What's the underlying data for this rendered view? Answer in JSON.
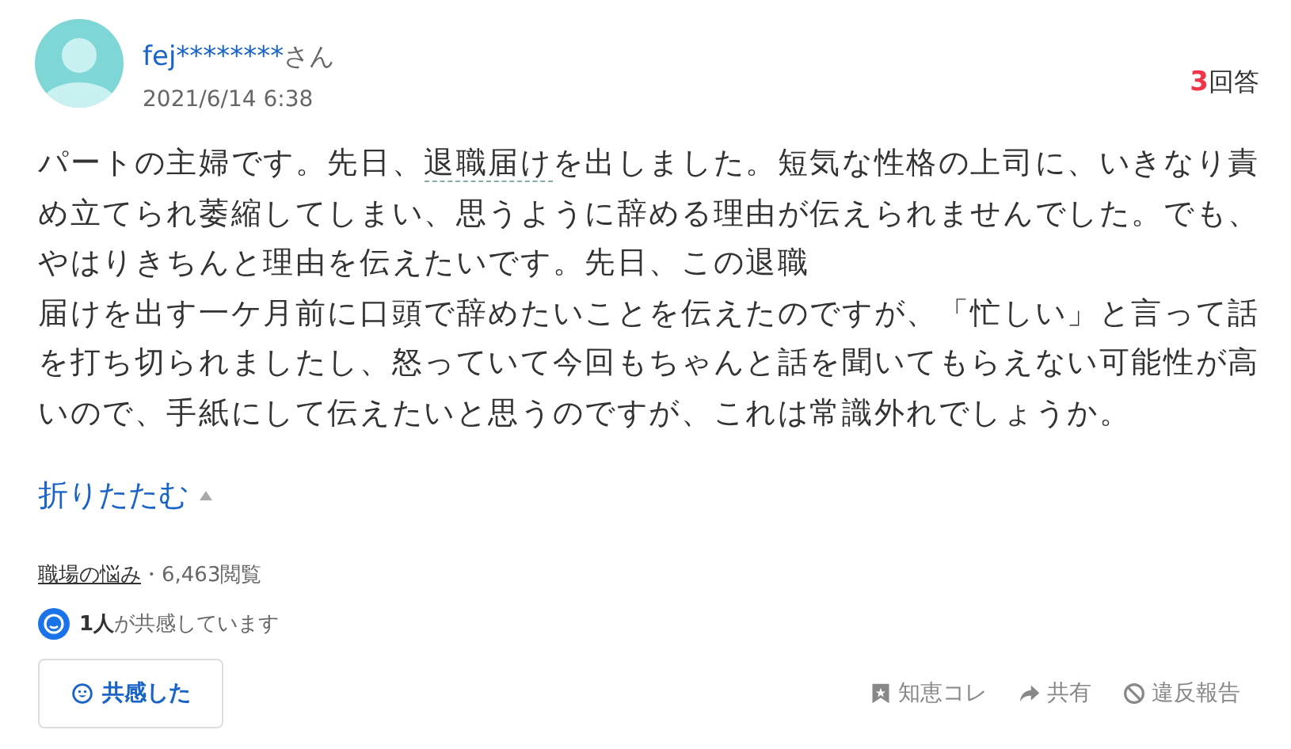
{
  "author": {
    "name": "fej********",
    "suffix": "さん",
    "date": "2021/6/14 6:38"
  },
  "answers": {
    "count": "3",
    "label": "回答"
  },
  "body": [
    [
      {
        "kind": "text",
        "text": "パートの主婦です。先日、"
      },
      {
        "kind": "keyword",
        "text": "退職届け"
      },
      {
        "kind": "text",
        "text": "を出しました。短気な性格の上司に、いきなり責め立てられ萎縮してしまい、思うように辞める理由が伝えられませんでした。でも、やはりきちんと理由を伝えたいです。先日、この退職"
      }
    ],
    [
      {
        "kind": "text",
        "text": "届けを出す一ケ月前に口頭で辞めたいことを伝えたのですが、「忙しい」と言って話を打ち切られましたし、怒っていて今回もちゃんと話を聞いてもらえない可能性が高いので、手紙にして伝えたいと思うのですが、これは常識外れでしょうか。"
      }
    ]
  ],
  "fold": {
    "label": "折りたたむ",
    "expanded": true
  },
  "category": "職場の悩み",
  "views": "・6,463閲覧",
  "empathy": {
    "count": "1人",
    "text": "が共感しています"
  },
  "empathy_button": {
    "label": "共感した",
    "selected": false
  },
  "actions": [
    {
      "kind": "bookmark",
      "label": "知恵コレ"
    },
    {
      "kind": "share",
      "label": "共有"
    },
    {
      "kind": "report",
      "label": "違反報告"
    }
  ]
}
